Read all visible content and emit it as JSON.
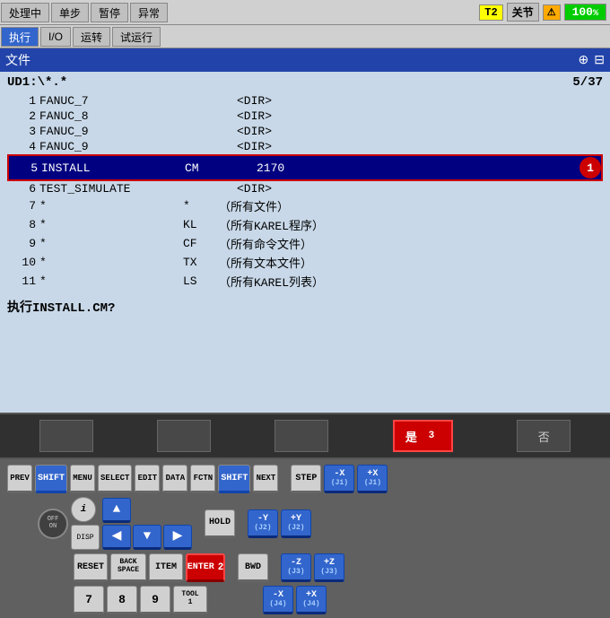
{
  "toolbar1": {
    "btn1": "处理中",
    "btn2": "单步",
    "btn3": "暂停",
    "btn4": "异常",
    "btn5": "执行",
    "btn6": "I/O",
    "btn7": "运转",
    "btn8": "试运行",
    "status_t2": "T2",
    "status_joint": "关节",
    "status_pct": "100",
    "status_pct_suffix": "%"
  },
  "file_header": {
    "title": "文件",
    "icon_plus": "⊕",
    "icon_grid": "⊟"
  },
  "file_list": {
    "path": "UD1:\\*.*",
    "counter": "5/37",
    "items": [
      {
        "num": "1",
        "name": "FANUC_7",
        "type": "",
        "extra": "<DIR>",
        "selected": false
      },
      {
        "num": "2",
        "name": "FANUC_8",
        "type": "",
        "extra": "<DIR>",
        "selected": false
      },
      {
        "num": "3",
        "name": "FANUC_9",
        "type": "",
        "extra": "<DIR>",
        "selected": false
      },
      {
        "num": "4",
        "name": "FANUC_9",
        "type": "",
        "extra": "<DIR>",
        "selected": false
      },
      {
        "num": "5",
        "name": "INSTALL",
        "type": "CM",
        "extra": "2170",
        "selected": true
      },
      {
        "num": "6",
        "name": "TEST_SIMULATE",
        "type": "",
        "extra": "<DIR>",
        "selected": false
      },
      {
        "num": "7",
        "name": "*",
        "type": "*",
        "extra": "（所有文件）",
        "selected": false
      },
      {
        "num": "8",
        "name": "*",
        "type": "KL",
        "extra": "（所有KAREL程序）",
        "selected": false
      },
      {
        "num": "9",
        "name": "*",
        "type": "CF",
        "extra": "（所有命令文件）",
        "selected": false
      },
      {
        "num": "10",
        "name": "*",
        "type": "TX",
        "extra": "（所有文本文件）",
        "selected": false
      },
      {
        "num": "11",
        "name": "*",
        "type": "LS",
        "extra": "（所有KAREL列表）",
        "selected": false
      }
    ],
    "confirm": "执行INSTALL.CM?"
  },
  "softkeys": {
    "yes": "是",
    "no": "否",
    "badge3": "3"
  },
  "keyboard": {
    "prev": "PREV",
    "shift": "SHIFT",
    "menu": "MENU",
    "select": "SELECT",
    "edit": "EDIT",
    "data": "DATA",
    "fctn": "FCTN",
    "next": "NEXT",
    "step": "STEP",
    "hold": "HOLD",
    "reset": "RESET",
    "backspace": "BACK\nSPACE",
    "item": "ITEM",
    "enter": "ENTER",
    "bwd": "BWD",
    "disp": "DISP",
    "offon": "OFF ON",
    "n7": "7",
    "n8": "8",
    "n9": "9",
    "tool1": "TOOL\n1",
    "j1p": "+X\n(J1)",
    "j1m": "-X\n(J1)",
    "j2p": "+Y\n(J2)",
    "j2m": "-Y\n(J2)",
    "j3p": "+Z\n(J3)",
    "j3m": "-Z\n(J3)",
    "j4p": "+X\n(J4)",
    "j4m": "-X\n(J4)",
    "badge2": "2"
  }
}
